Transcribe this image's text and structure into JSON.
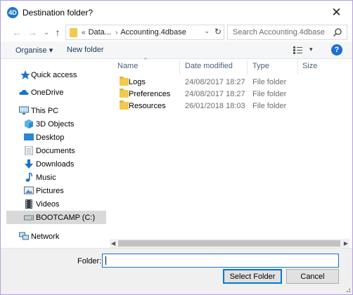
{
  "window": {
    "title": "Destination folder?",
    "app_icon_text": "4D",
    "close_glyph": "✕"
  },
  "nav": {
    "back_glyph": "←",
    "forward_glyph": "→",
    "dropdown_glyph": "⌄",
    "up_glyph": "↑"
  },
  "address": {
    "overflow": "«",
    "segments": [
      "Data...",
      "Accounting.4dbase"
    ],
    "separator": "›",
    "dropdown_glyph": "⌄",
    "refresh_glyph": "↻"
  },
  "search": {
    "placeholder": "Search Accounting.4dbase"
  },
  "toolbar": {
    "organise_label": "Organise ▾",
    "new_folder_label": "New folder",
    "view_dd_glyph": "▾",
    "help_glyph": "?"
  },
  "sidebar": {
    "items": [
      {
        "label": "Quick access",
        "icon": "star-icon"
      },
      {
        "label": "OneDrive",
        "icon": "cloud-icon"
      },
      {
        "label": "This PC",
        "icon": "monitor-icon"
      },
      {
        "label": "3D Objects",
        "icon": "cube-icon"
      },
      {
        "label": "Desktop",
        "icon": "desktop-icon"
      },
      {
        "label": "Documents",
        "icon": "documents-icon"
      },
      {
        "label": "Downloads",
        "icon": "download-icon"
      },
      {
        "label": "Music",
        "icon": "music-icon"
      },
      {
        "label": "Pictures",
        "icon": "pictures-icon"
      },
      {
        "label": "Videos",
        "icon": "videos-icon"
      },
      {
        "label": "BOOTCAMP (C:)",
        "icon": "drive-icon",
        "selected": true
      },
      {
        "label": "Network",
        "icon": "network-icon"
      }
    ]
  },
  "columns": {
    "name": "Name",
    "date": "Date modified",
    "type": "Type",
    "size": "Size",
    "sort_glyph": "^"
  },
  "files": [
    {
      "name": "Logs",
      "date": "24/08/2017 18:27",
      "type": "File folder"
    },
    {
      "name": "Preferences",
      "date": "24/08/2017 18:27",
      "type": "File folder"
    },
    {
      "name": "Resources",
      "date": "26/01/2018 18:03",
      "type": "File folder"
    }
  ],
  "scroll": {
    "left_glyph": "◀",
    "right_glyph": "▶"
  },
  "footer": {
    "folder_label": "Folder:",
    "folder_value": "",
    "select_button": "Select Folder",
    "cancel_button": "Cancel"
  },
  "colors": {
    "accent": "#0078d7",
    "folder": "#f2c94c",
    "selection": "#d9d9d9"
  }
}
